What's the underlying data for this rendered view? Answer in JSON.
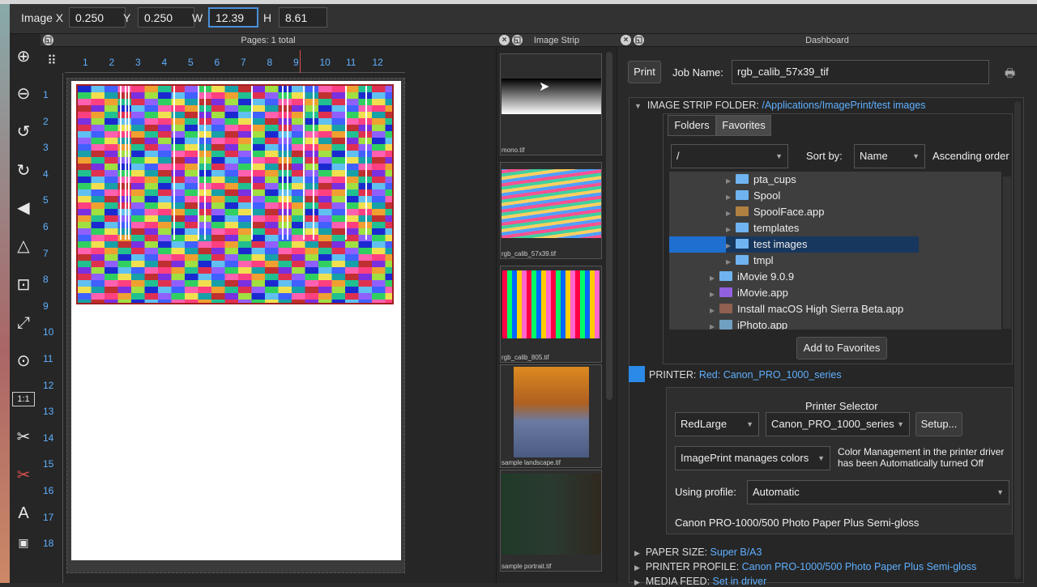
{
  "toolbar": {
    "x_label": "Image X",
    "x_value": "0.250",
    "y_label": "Y",
    "y_value": "0.250",
    "w_label": "W",
    "w_value": "12.39",
    "h_label": "H",
    "h_value": "8.61"
  },
  "page_panel": {
    "title": "Pages: 1 total"
  },
  "strip_panel": {
    "title": "Image Strip",
    "thumbs": [
      "mono.tif",
      "rgb_calib_57x39.tif",
      "rgb_calib_805.tif",
      "sample landscape.tif",
      "sample portrait.tif"
    ]
  },
  "dashboard": {
    "title": "Dashboard",
    "print_label": "Print",
    "job_label": "Job Name:",
    "job_value": "rgb_calib_57x39_tif",
    "folder_label": "IMAGE STRIP FOLDER:",
    "folder_path": "/Applications/ImagePrint/test images",
    "tabs": [
      "Folders",
      "Favorites"
    ],
    "path_value": "/",
    "sort_label": "Sort by:",
    "sort_value": "Name",
    "order_label": "Ascending order",
    "tree": [
      "pta_cups",
      "Spool",
      "SpoolFace.app",
      "templates",
      "test images",
      "tmpl",
      "iMovie 9.0.9",
      "iMovie.app",
      "Install macOS High Sierra Beta.app",
      "iPhoto.app"
    ],
    "add_fav": "Add to Favorites",
    "printer_label": "PRINTER:",
    "printer_value": "Red: Canon_PRO_1000_series",
    "selector_title": "Printer Selector",
    "size_value": "RedLarge",
    "printer_sel": "Canon_PRO_1000_series",
    "setup_label": "Setup...",
    "color_value": "ImagePrint manages colors",
    "color_note": "Color Management in the printer driver has been Automatically turned Off",
    "profile_label": "Using profile:",
    "profile_value": "Automatic",
    "paper_text": "Canon PRO-1000/500 Photo Paper Plus Semi-gloss",
    "paper_size_label": "PAPER SIZE:",
    "paper_size_value": "Super B/A3",
    "profile_sec_label": "PRINTER PROFILE:",
    "profile_sec_value": "Canon PRO-1000/500 Photo Paper Plus Semi-gloss",
    "feed_label": "MEDIA FEED:",
    "feed_value": "Set in driver"
  },
  "ruler_top": [
    "1",
    "2",
    "3",
    "4",
    "5",
    "6",
    "7",
    "8",
    "9",
    "10",
    "11",
    "12"
  ],
  "ruler_left": [
    "1",
    "2",
    "3",
    "4",
    "5",
    "6",
    "7",
    "8",
    "9",
    "10",
    "11",
    "12",
    "13",
    "14",
    "15",
    "16",
    "17",
    "18"
  ],
  "colors": {
    "accent": "#5fb0ff",
    "selection": "#1e6fd0",
    "frame": "#a02020"
  }
}
